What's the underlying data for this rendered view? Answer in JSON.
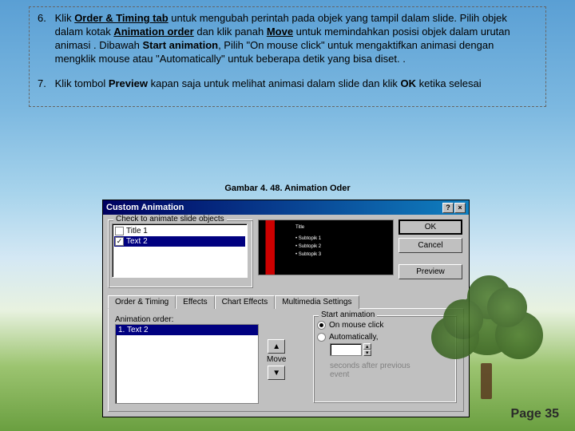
{
  "steps": {
    "n6": "6.",
    "t6_a": "Klik ",
    "t6_b": "Order & Timing tab",
    "t6_c": " untuk mengubah perintah pada objek yang tampil dalam slide. Pilih objek dalam kotak ",
    "t6_d": "Animation order",
    "t6_e": " dan klik panah ",
    "t6_f": "Move",
    "t6_g": " untuk memindahkan posisi objek dalam urutan animasi . Dibawah ",
    "t6_h": "Start animation",
    "t6_i": ", Pilih \"On mouse click\" untuk mengaktifkan animasi dengan mengklik mouse atau \"Automatically\" untuk beberapa detik yang bisa diset. .",
    "n7": "7.",
    "t7_a": "Klik tombol ",
    "t7_b": "Preview",
    "t7_c": " kapan saja untuk melihat animasi dalam slide dan klik ",
    "t7_d": "OK",
    "t7_e": " ketika selesai"
  },
  "caption": "Gambar 4. 48. Animation Oder",
  "dialog": {
    "title": "Custom Animation",
    "help": "?",
    "close": "×",
    "group_objects": "Check to animate slide objects",
    "obj1": "Title 1",
    "obj2": "Text 2",
    "check": "✓",
    "pv1": "Title",
    "pv2": "• Subtopik 1",
    "pv3": "• Subtopik 2",
    "pv4": "• Subtopik 3",
    "btn_ok": "OK",
    "btn_cancel": "Cancel",
    "btn_preview": "Preview",
    "tabs": {
      "t1": "Order & Timing",
      "t2": "Effects",
      "t3": "Chart Effects",
      "t4": "Multimedia Settings"
    },
    "order_label": "Animation order:",
    "order_item": "1. Text 2",
    "move_label": "Move",
    "arrow_up": "▲",
    "arrow_dn": "▼",
    "start_label": "Start animation",
    "radio1": "On mouse click",
    "radio2": "Automatically,",
    "spin_up": "▴",
    "spin_dn": "▾",
    "after1": "seconds after previous",
    "after2": "event"
  },
  "page": "Page  35"
}
